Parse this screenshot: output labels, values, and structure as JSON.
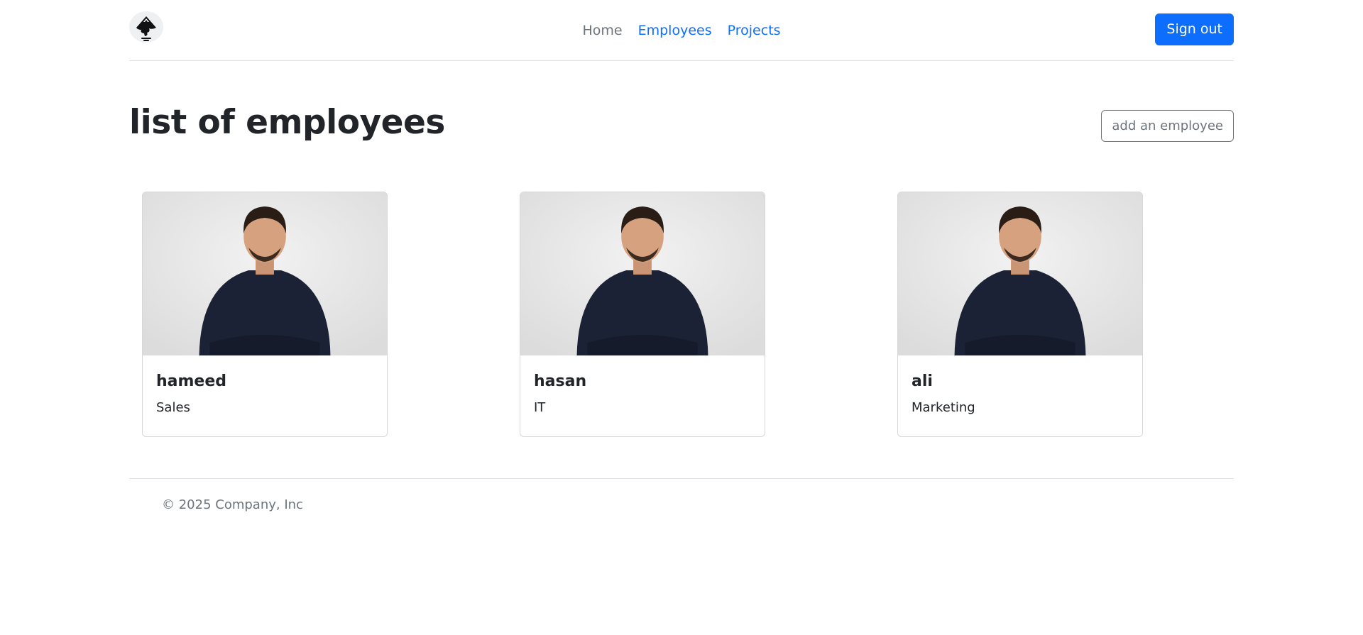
{
  "header": {
    "logo": "inkscape-logo-icon",
    "nav": [
      {
        "label": "Home",
        "style": "muted"
      },
      {
        "label": "Employees",
        "style": "primary"
      },
      {
        "label": "Projects",
        "style": "primary"
      }
    ],
    "signout_label": "Sign out"
  },
  "main": {
    "title": "list of employees",
    "add_label": "add an employee",
    "employees": [
      {
        "name": "hameed",
        "department": "Sales",
        "photo": "employee-photo"
      },
      {
        "name": "hasan",
        "department": "IT",
        "photo": "employee-photo"
      },
      {
        "name": "ali",
        "department": "Marketing",
        "photo": "employee-photo"
      }
    ]
  },
  "footer": {
    "text": "© 2025 Company, Inc"
  },
  "colors": {
    "primary": "#0d6efd",
    "muted": "#6c757d",
    "border": "#dee2e6",
    "text": "#212529"
  }
}
